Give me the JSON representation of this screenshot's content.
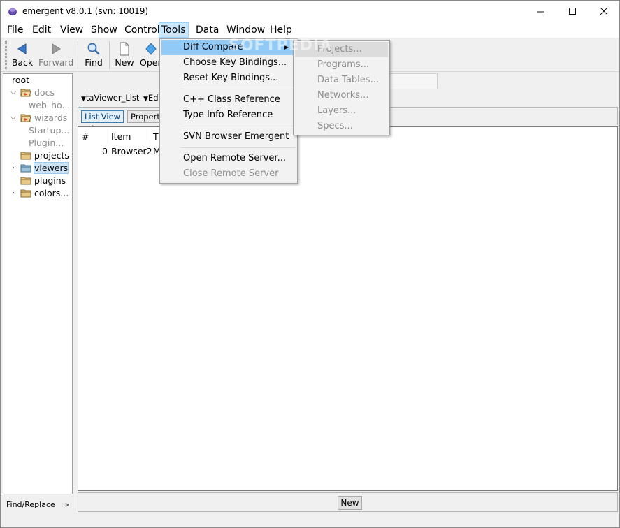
{
  "window": {
    "title": "emergent v8.0.1 (svn: 10019)"
  },
  "menubar": [
    "File",
    "Edit",
    "View",
    "Show",
    "Control",
    "Tools",
    "Data",
    "Window",
    "Help"
  ],
  "toolbar": {
    "back": "Back",
    "forward": "Forward",
    "find": "Find",
    "new": "New",
    "open": "Open"
  },
  "tree": {
    "root": "root",
    "docs": "docs",
    "web_ho": "web_ho...",
    "wizards": "wizards",
    "startup": "Startup...",
    "plugin": "Plugin...",
    "projects": "projects",
    "viewers": "viewers",
    "plugins": "plugins",
    "colors": "colors..."
  },
  "findbar": {
    "label": "Find/Replace",
    "more": "»"
  },
  "subbar": {
    "dropdown1": "taViewer_List",
    "dropdown2": "Edit"
  },
  "viewtabs": {
    "list_view": "List View",
    "properties": "Properties"
  },
  "list": {
    "headers": {
      "index": "#",
      "item": "Item",
      "type": "T"
    },
    "rows": [
      {
        "index": "0",
        "item": "Browser2",
        "type": "M"
      }
    ]
  },
  "bottom": {
    "new_button": "New"
  },
  "tools_menu": {
    "diff_compare": "Diff Compare",
    "choose_key": "Choose Key Bindings...",
    "reset_key": "Reset Key Bindings...",
    "cpp_ref": "C++ Class Reference",
    "type_info": "Type Info Reference",
    "svn_browser": "SVN Browser Emergent",
    "open_remote": "Open Remote Server...",
    "close_remote": "Close Remote Server"
  },
  "diff_submenu": [
    "Projects...",
    "Programs...",
    "Data Tables...",
    "Networks...",
    "Layers...",
    "Specs..."
  ],
  "watermark": "SOFTPEDIA"
}
